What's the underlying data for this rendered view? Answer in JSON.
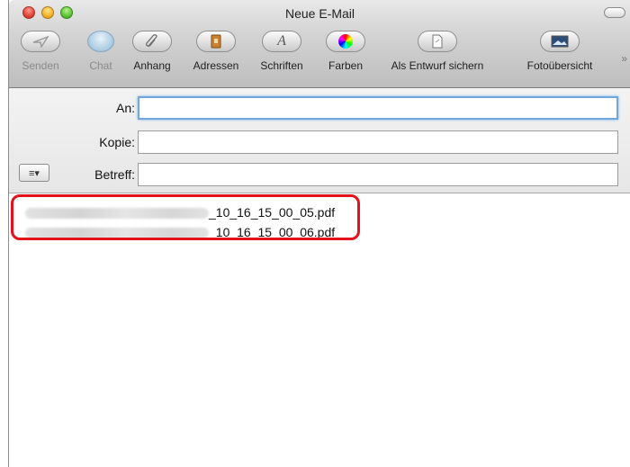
{
  "window": {
    "title": "Neue E-Mail"
  },
  "toolbar": {
    "buttons": [
      {
        "label": "Senden",
        "icon": "paper-plane-icon",
        "enabled": false
      },
      {
        "label": "Chat",
        "icon": "chat-bubble-icon",
        "enabled": false
      },
      {
        "label": "Anhang",
        "icon": "paperclip-icon",
        "enabled": true
      },
      {
        "label": "Adressen",
        "icon": "address-book-icon",
        "enabled": true
      },
      {
        "label": "Schriften",
        "icon": "font-icon",
        "enabled": true
      },
      {
        "label": "Farben",
        "icon": "color-wheel-icon",
        "enabled": true
      },
      {
        "label": "Als Entwurf sichern",
        "icon": "draft-icon",
        "enabled": true
      },
      {
        "label": "Fotoübersicht",
        "icon": "photo-browser-icon",
        "enabled": true
      }
    ],
    "overflow_glyph": "»"
  },
  "headers": {
    "to_label": "An:",
    "cc_label": "Kopie:",
    "subject_label": "Betreff:",
    "to_value": "",
    "cc_value": "",
    "subject_value": "",
    "menu_glyph": "≡▾"
  },
  "attachments": [
    {
      "filename_suffix": "_10_16_15_00_05.pdf"
    },
    {
      "filename_suffix": "_10_16_15_00_06.pdf"
    }
  ],
  "colors": {
    "highlight": "#e3121b",
    "focus_ring": "#6fa7dc"
  }
}
